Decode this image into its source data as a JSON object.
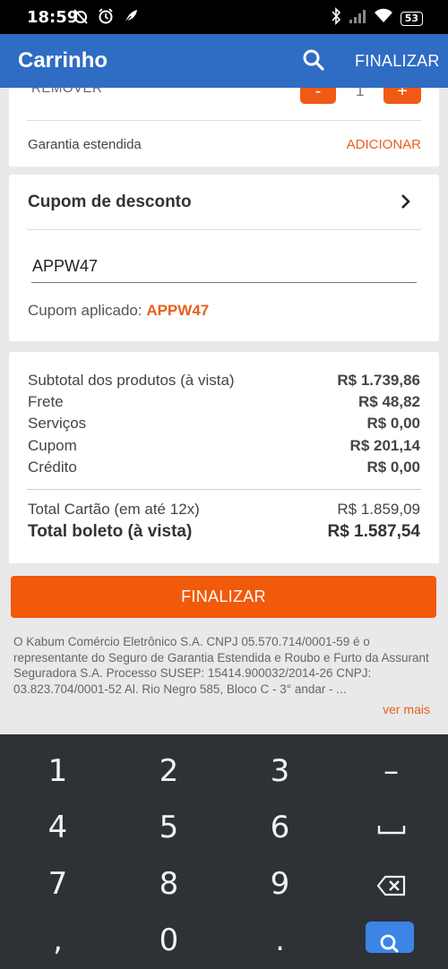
{
  "status_bar": {
    "time": "18:59",
    "battery": "53",
    "icons": [
      "alarm-off-icon",
      "alarm-clock-icon",
      "feather-icon",
      "bluetooth-icon",
      "signal-icon",
      "wifi-icon",
      "battery-icon"
    ]
  },
  "app_bar": {
    "title": "Carrinho",
    "finalize_label": "FINALIZAR",
    "background": "#2f6cc4"
  },
  "product_card": {
    "remove_label": "REMOVER",
    "minus_label": "-",
    "plus_label": "+",
    "quantity": "1",
    "warranty_label": "Garantia estendida",
    "add_label": "ADICIONAR"
  },
  "coupon_card": {
    "title": "Cupom de desconto",
    "input_value": "APPW47",
    "applied_label": "Cupom aplicado: ",
    "applied_code": "APPW47"
  },
  "summary": {
    "rows": [
      {
        "label": "Subtotal dos produtos (à vista)",
        "value": "R$ 1.739,86"
      },
      {
        "label": "Frete",
        "value": "R$ 48,82"
      },
      {
        "label": "Serviços",
        "value": "R$ 0,00"
      },
      {
        "label": "Cupom",
        "value": "R$ 201,14"
      },
      {
        "label": "Crédito",
        "value": "R$ 0,00"
      }
    ],
    "card_total_label": "Total Cartão (em até 12x)",
    "card_total_value": "R$ 1.859,09",
    "boleto_total_label": "Total boleto (à vista)",
    "boleto_total_value": "R$ 1.587,54"
  },
  "finalize_button": {
    "label": "FINALIZAR",
    "color": "#f05a0a"
  },
  "legal": {
    "text": "O Kabum Comércio Eletrônico S.A. CNPJ 05.570.714/0001-59 é o representante do Seguro de Garantia Estendida e Roubo e Furto da Assurant Seguradora S.A. Processo SUSEP: 15414.900032/2014-26 CNPJ: 03.823.704/0001-52 Al. Rio Negro 585, Bloco C - 3° andar - ...",
    "more_label": "ver mais"
  },
  "keyboard": {
    "keys": [
      "1",
      "2",
      "3",
      "–",
      "4",
      "5",
      "6",
      "␣",
      "7",
      "8",
      "9",
      "backspace",
      ",",
      "0",
      ".",
      "search"
    ]
  },
  "colors": {
    "accent_orange": "#e8601c",
    "keyboard_bg": "#2e3236",
    "search_key": "#3c84e6"
  }
}
